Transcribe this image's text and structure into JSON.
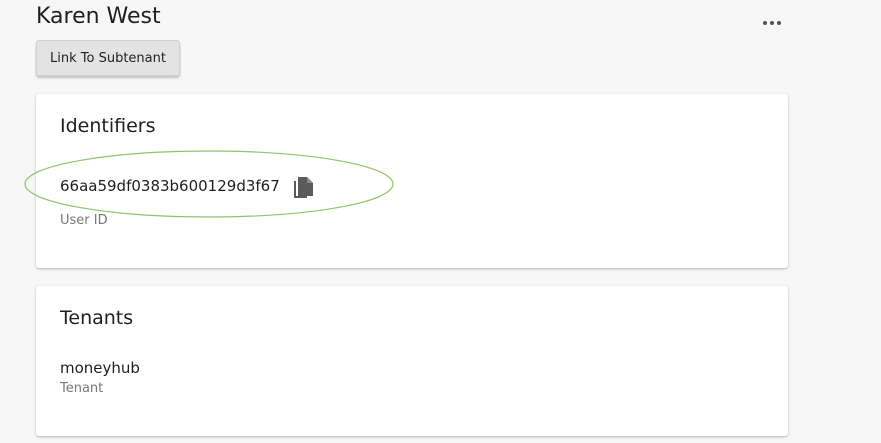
{
  "header": {
    "title": "Karen West",
    "more_icon": "more-horizontal-icon",
    "link_button_label": "Link To Subtenant"
  },
  "identifiers_card": {
    "title": "Identifiers",
    "user_id": "66aa59df0383b600129d3f67",
    "user_id_label": "User ID",
    "copy_icon": "copy-icon"
  },
  "tenants_card": {
    "title": "Tenants",
    "tenant_name": "moneyhub",
    "tenant_label": "Tenant"
  },
  "colors": {
    "background": "#f7f7f7",
    "card": "#ffffff",
    "highlight": "#8fc46a"
  }
}
